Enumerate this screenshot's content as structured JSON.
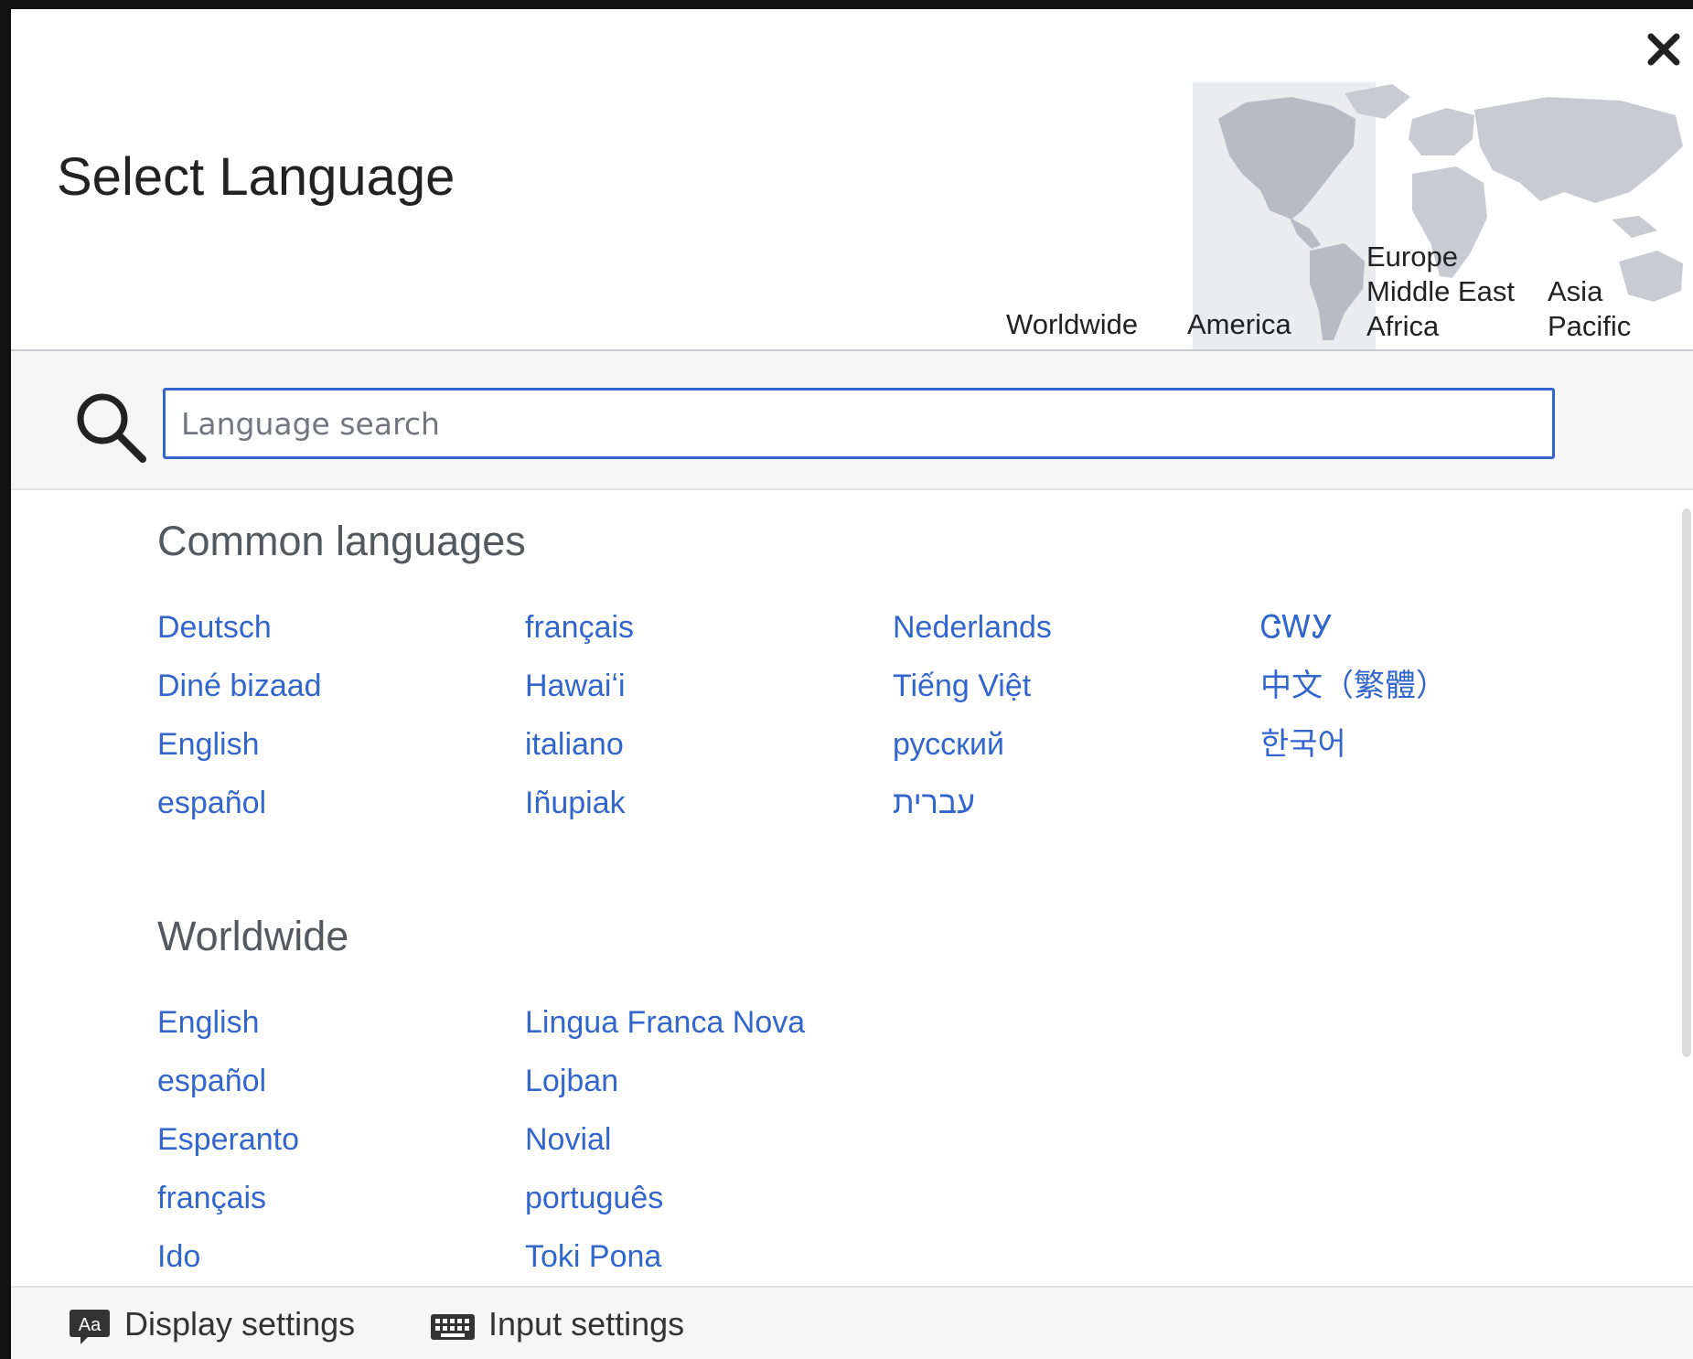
{
  "header": {
    "title": "Select Language",
    "close_icon": "close-icon"
  },
  "regions": [
    {
      "label_lines": [
        "Worldwide"
      ],
      "selected": false
    },
    {
      "label_lines": [
        "America"
      ],
      "selected": true
    },
    {
      "label_lines": [
        "Europe",
        "Middle East",
        "Africa"
      ],
      "selected": false
    },
    {
      "label_lines": [
        "Asia",
        "Pacific"
      ],
      "selected": false
    }
  ],
  "search": {
    "placeholder": "Language search",
    "value": "",
    "icon": "search-icon"
  },
  "common_languages": {
    "title": "Common languages",
    "columns": [
      [
        "Deutsch",
        "Diné bizaad",
        "English",
        "español"
      ],
      [
        "français",
        "Hawaiʻi",
        "italiano",
        "Iñupiak"
      ],
      [
        "Nederlands",
        "Tiếng Việt",
        "русский",
        "עברית"
      ],
      [
        "ᏣᎳᎩ",
        "中文（繁體）",
        "한국어"
      ]
    ]
  },
  "worldwide": {
    "title": "Worldwide",
    "columns": [
      [
        "English",
        "español",
        "Esperanto",
        "français",
        "Ido"
      ],
      [
        "Lingua Franca Nova",
        "Lojban",
        "Novial",
        "português",
        "Toki Pona"
      ]
    ]
  },
  "footer": {
    "display_settings": "Display settings",
    "input_settings": "Input settings"
  },
  "colors": {
    "link": "#3366cc",
    "accent": "#36c",
    "map_land": "#c8ccd1",
    "map_selected_bg": "#eaecf0"
  }
}
